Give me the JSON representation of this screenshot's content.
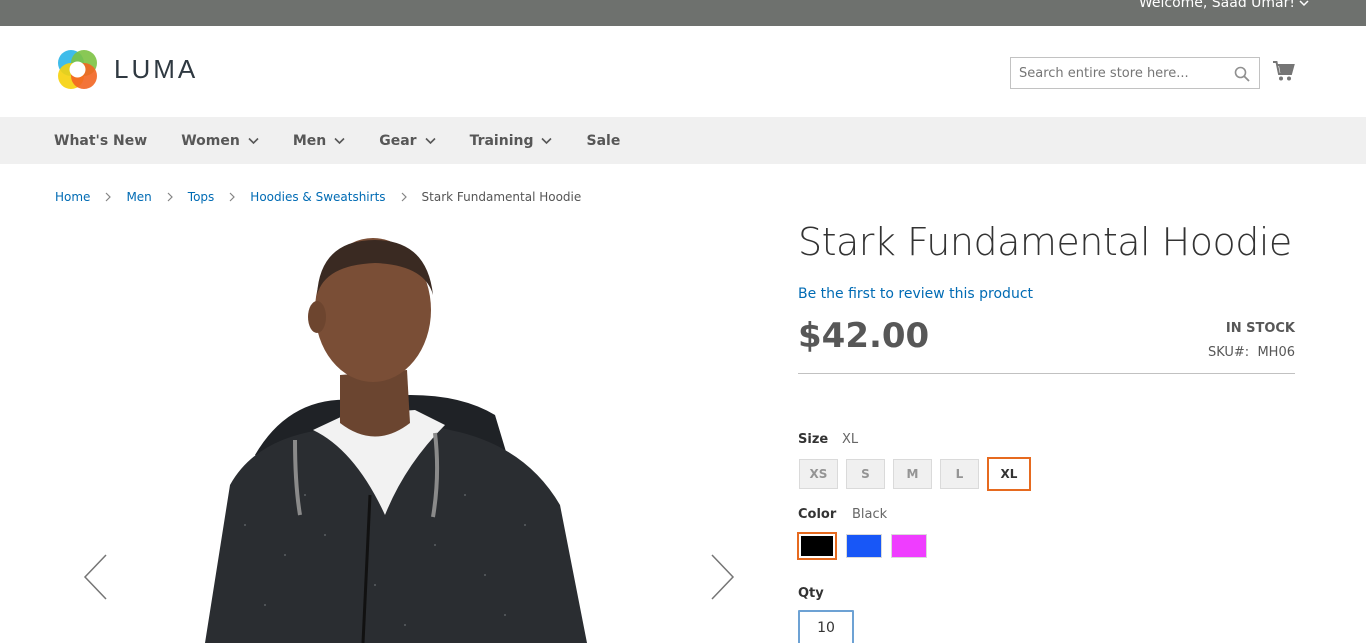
{
  "header": {
    "welcome_text": "Welcome, Saad Umar!",
    "logo_text": "LUMA",
    "search_placeholder": "Search entire store here..."
  },
  "nav": {
    "items": [
      {
        "label": "What's New",
        "has_dropdown": false
      },
      {
        "label": "Women",
        "has_dropdown": true
      },
      {
        "label": "Men",
        "has_dropdown": true
      },
      {
        "label": "Gear",
        "has_dropdown": true
      },
      {
        "label": "Training",
        "has_dropdown": true
      },
      {
        "label": "Sale",
        "has_dropdown": false
      }
    ]
  },
  "breadcrumb": {
    "links": [
      "Home",
      "Men",
      "Tops",
      "Hoodies & Sweatshirts"
    ],
    "current": "Stark Fundamental Hoodie"
  },
  "product": {
    "title": "Stark Fundamental Hoodie",
    "review_link": "Be the first to review this product",
    "price": "$42.00",
    "stock": "IN STOCK",
    "sku_label": "SKU#:",
    "sku": "MH06"
  },
  "options": {
    "size_label": "Size",
    "size_selected": "XL",
    "sizes": [
      "XS",
      "S",
      "M",
      "L",
      "XL"
    ],
    "color_label": "Color",
    "color_selected": "Black",
    "colors": [
      {
        "name": "Black",
        "hex": "#000000",
        "selected": true
      },
      {
        "name": "Blue",
        "hex": "#1857f7",
        "selected": false
      },
      {
        "name": "Purple",
        "hex": "#ef3dff",
        "selected": false
      }
    ],
    "qty_label": "Qty",
    "qty_value": "10"
  },
  "colors": {
    "link": "#006bb4",
    "accent_selected": "#e66a1f",
    "topbar": "#6e716e",
    "navbar": "#f0f0f0"
  },
  "icons": {
    "search": "search-icon",
    "cart": "cart-icon",
    "prev": "chevron-left-icon",
    "next": "chevron-right-icon"
  }
}
